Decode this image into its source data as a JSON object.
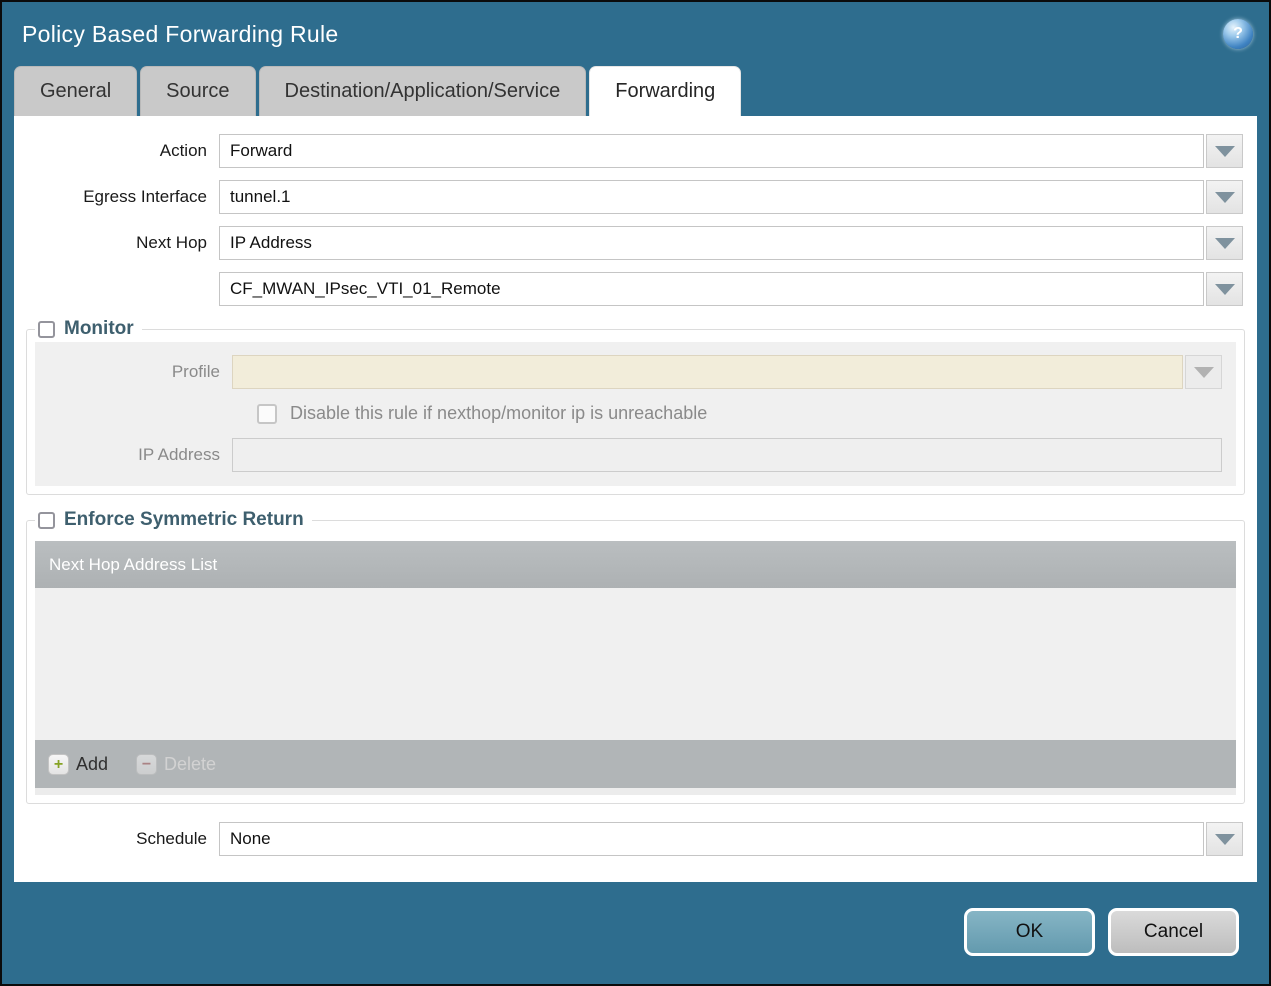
{
  "dialog": {
    "title": "Policy Based Forwarding Rule",
    "help_icon": "?"
  },
  "tabs": [
    {
      "label": "General",
      "active": false
    },
    {
      "label": "Source",
      "active": false
    },
    {
      "label": "Destination/Application/Service",
      "active": false
    },
    {
      "label": "Forwarding",
      "active": true
    }
  ],
  "form": {
    "action": {
      "label": "Action",
      "value": "Forward"
    },
    "egress_interface": {
      "label": "Egress Interface",
      "value": "tunnel.1"
    },
    "next_hop": {
      "label": "Next Hop",
      "value": "IP Address"
    },
    "next_hop_address": {
      "value": "CF_MWAN_IPsec_VTI_01_Remote"
    },
    "schedule": {
      "label": "Schedule",
      "value": "None"
    }
  },
  "monitor": {
    "legend": "Monitor",
    "checked": false,
    "enabled": false,
    "profile": {
      "label": "Profile",
      "value": ""
    },
    "disable_rule": {
      "label": "Disable this rule if nexthop/monitor ip is unreachable",
      "checked": false
    },
    "ip_address": {
      "label": "IP Address",
      "value": ""
    }
  },
  "symmetric_return": {
    "legend": "Enforce Symmetric Return",
    "checked": false,
    "table": {
      "header": "Next Hop Address List",
      "rows": []
    },
    "add_label": "Add",
    "delete_label": "Delete",
    "delete_enabled": false
  },
  "footer": {
    "ok_label": "OK",
    "cancel_label": "Cancel"
  },
  "colors": {
    "titlebar_background": "#2e6d8e",
    "inactive_tab": "#c9c9c9",
    "active_tab": "#ffffff",
    "legend_text": "#3e5f6e",
    "disabled_section_background": "#f0f0f0",
    "profile_field_background": "#f2edda",
    "table_header_background": "#b3b7b9",
    "ok_button": "#6fa3b8",
    "cancel_button": "#c9c9c9",
    "add_plus_green": "#86a324",
    "delete_minus_red": "#a65c5c"
  }
}
